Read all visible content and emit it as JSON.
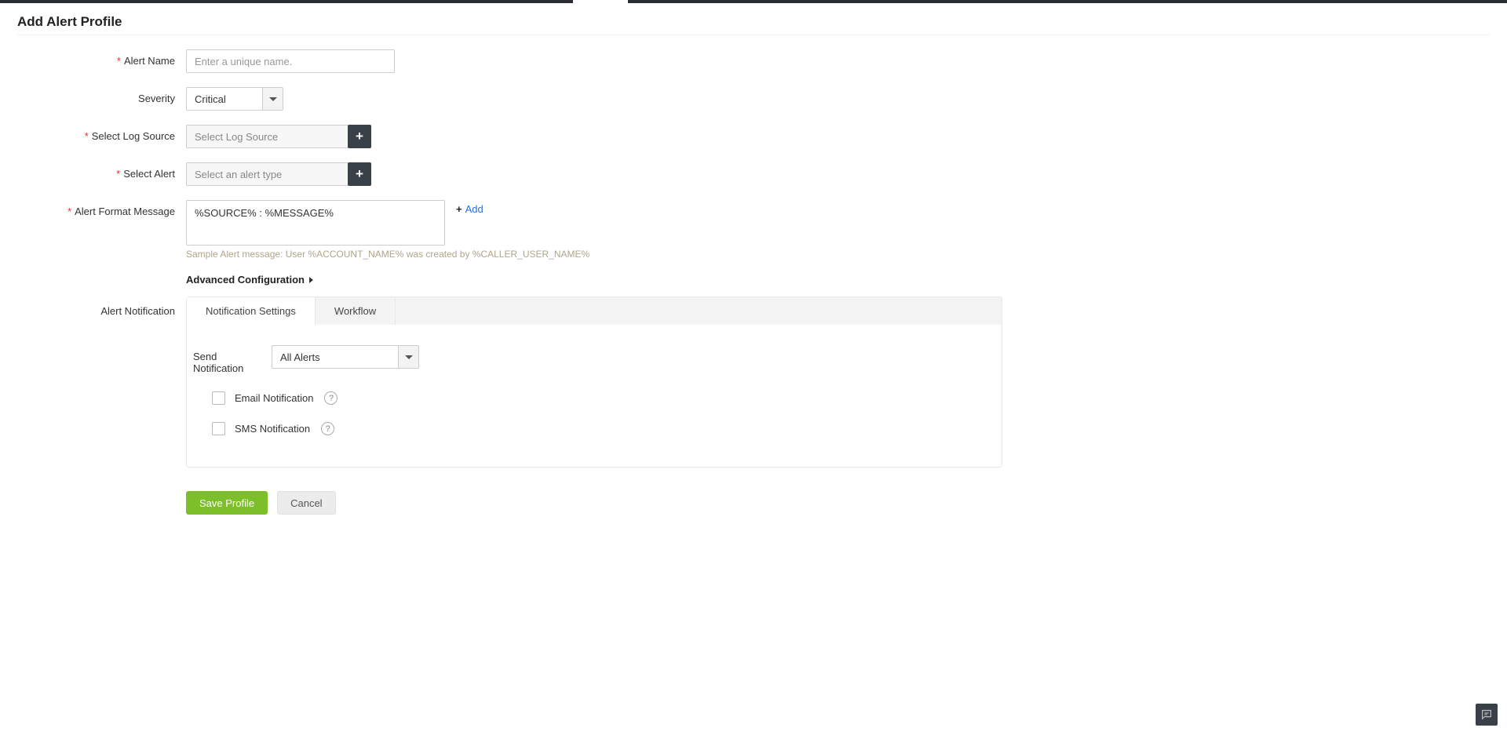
{
  "page": {
    "title": "Add Alert Profile"
  },
  "fields": {
    "alertName": {
      "label": "Alert Name",
      "placeholder": "Enter a unique name."
    },
    "severity": {
      "label": "Severity",
      "value": "Critical"
    },
    "logSource": {
      "label": "Select Log Source",
      "placeholder": "Select Log Source"
    },
    "selectAlert": {
      "label": "Select Alert",
      "placeholder": "Select an alert type"
    },
    "alertFormat": {
      "label": "Alert Format Message",
      "value": "%SOURCE% : %MESSAGE%",
      "hint": "Sample Alert message: User %ACCOUNT_NAME% was created by %CALLER_USER_NAME%",
      "addLabel": "Add"
    },
    "advanced": {
      "label": "Advanced Configuration"
    },
    "alertNotification": {
      "label": "Alert Notification"
    }
  },
  "tabs": {
    "notificationSettings": "Notification Settings",
    "workflow": "Workflow"
  },
  "notification": {
    "sendLabel": "Send Notification",
    "sendValue": "All Alerts",
    "email": "Email Notification",
    "sms": "SMS Notification"
  },
  "buttons": {
    "save": "Save Profile",
    "cancel": "Cancel"
  }
}
